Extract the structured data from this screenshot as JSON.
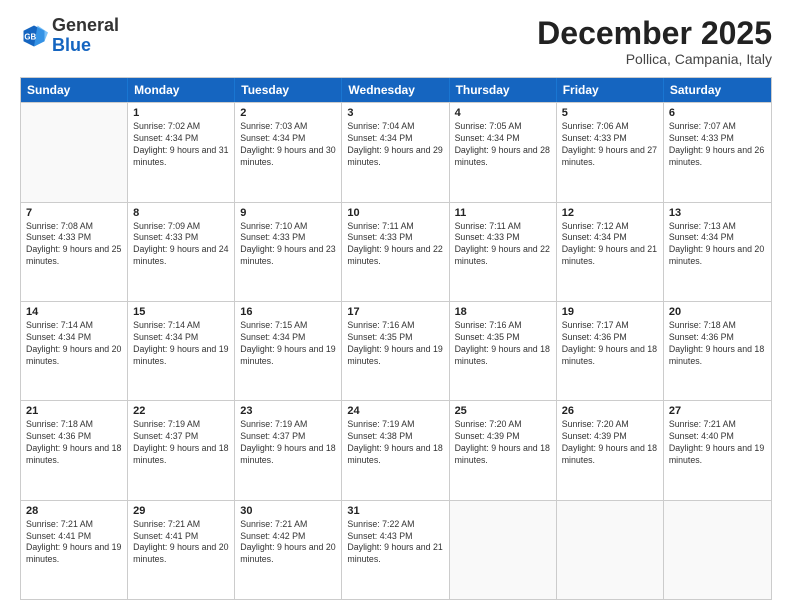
{
  "logo": {
    "general": "General",
    "blue": "Blue"
  },
  "header": {
    "month": "December 2025",
    "location": "Pollica, Campania, Italy"
  },
  "days_of_week": [
    "Sunday",
    "Monday",
    "Tuesday",
    "Wednesday",
    "Thursday",
    "Friday",
    "Saturday"
  ],
  "weeks": [
    [
      {
        "day": "",
        "sunrise": "",
        "sunset": "",
        "daylight": ""
      },
      {
        "day": "1",
        "sunrise": "Sunrise: 7:02 AM",
        "sunset": "Sunset: 4:34 PM",
        "daylight": "Daylight: 9 hours and 31 minutes."
      },
      {
        "day": "2",
        "sunrise": "Sunrise: 7:03 AM",
        "sunset": "Sunset: 4:34 PM",
        "daylight": "Daylight: 9 hours and 30 minutes."
      },
      {
        "day": "3",
        "sunrise": "Sunrise: 7:04 AM",
        "sunset": "Sunset: 4:34 PM",
        "daylight": "Daylight: 9 hours and 29 minutes."
      },
      {
        "day": "4",
        "sunrise": "Sunrise: 7:05 AM",
        "sunset": "Sunset: 4:34 PM",
        "daylight": "Daylight: 9 hours and 28 minutes."
      },
      {
        "day": "5",
        "sunrise": "Sunrise: 7:06 AM",
        "sunset": "Sunset: 4:33 PM",
        "daylight": "Daylight: 9 hours and 27 minutes."
      },
      {
        "day": "6",
        "sunrise": "Sunrise: 7:07 AM",
        "sunset": "Sunset: 4:33 PM",
        "daylight": "Daylight: 9 hours and 26 minutes."
      }
    ],
    [
      {
        "day": "7",
        "sunrise": "Sunrise: 7:08 AM",
        "sunset": "Sunset: 4:33 PM",
        "daylight": "Daylight: 9 hours and 25 minutes."
      },
      {
        "day": "8",
        "sunrise": "Sunrise: 7:09 AM",
        "sunset": "Sunset: 4:33 PM",
        "daylight": "Daylight: 9 hours and 24 minutes."
      },
      {
        "day": "9",
        "sunrise": "Sunrise: 7:10 AM",
        "sunset": "Sunset: 4:33 PM",
        "daylight": "Daylight: 9 hours and 23 minutes."
      },
      {
        "day": "10",
        "sunrise": "Sunrise: 7:11 AM",
        "sunset": "Sunset: 4:33 PM",
        "daylight": "Daylight: 9 hours and 22 minutes."
      },
      {
        "day": "11",
        "sunrise": "Sunrise: 7:11 AM",
        "sunset": "Sunset: 4:33 PM",
        "daylight": "Daylight: 9 hours and 22 minutes."
      },
      {
        "day": "12",
        "sunrise": "Sunrise: 7:12 AM",
        "sunset": "Sunset: 4:34 PM",
        "daylight": "Daylight: 9 hours and 21 minutes."
      },
      {
        "day": "13",
        "sunrise": "Sunrise: 7:13 AM",
        "sunset": "Sunset: 4:34 PM",
        "daylight": "Daylight: 9 hours and 20 minutes."
      }
    ],
    [
      {
        "day": "14",
        "sunrise": "Sunrise: 7:14 AM",
        "sunset": "Sunset: 4:34 PM",
        "daylight": "Daylight: 9 hours and 20 minutes."
      },
      {
        "day": "15",
        "sunrise": "Sunrise: 7:14 AM",
        "sunset": "Sunset: 4:34 PM",
        "daylight": "Daylight: 9 hours and 19 minutes."
      },
      {
        "day": "16",
        "sunrise": "Sunrise: 7:15 AM",
        "sunset": "Sunset: 4:34 PM",
        "daylight": "Daylight: 9 hours and 19 minutes."
      },
      {
        "day": "17",
        "sunrise": "Sunrise: 7:16 AM",
        "sunset": "Sunset: 4:35 PM",
        "daylight": "Daylight: 9 hours and 19 minutes."
      },
      {
        "day": "18",
        "sunrise": "Sunrise: 7:16 AM",
        "sunset": "Sunset: 4:35 PM",
        "daylight": "Daylight: 9 hours and 18 minutes."
      },
      {
        "day": "19",
        "sunrise": "Sunrise: 7:17 AM",
        "sunset": "Sunset: 4:36 PM",
        "daylight": "Daylight: 9 hours and 18 minutes."
      },
      {
        "day": "20",
        "sunrise": "Sunrise: 7:18 AM",
        "sunset": "Sunset: 4:36 PM",
        "daylight": "Daylight: 9 hours and 18 minutes."
      }
    ],
    [
      {
        "day": "21",
        "sunrise": "Sunrise: 7:18 AM",
        "sunset": "Sunset: 4:36 PM",
        "daylight": "Daylight: 9 hours and 18 minutes."
      },
      {
        "day": "22",
        "sunrise": "Sunrise: 7:19 AM",
        "sunset": "Sunset: 4:37 PM",
        "daylight": "Daylight: 9 hours and 18 minutes."
      },
      {
        "day": "23",
        "sunrise": "Sunrise: 7:19 AM",
        "sunset": "Sunset: 4:37 PM",
        "daylight": "Daylight: 9 hours and 18 minutes."
      },
      {
        "day": "24",
        "sunrise": "Sunrise: 7:19 AM",
        "sunset": "Sunset: 4:38 PM",
        "daylight": "Daylight: 9 hours and 18 minutes."
      },
      {
        "day": "25",
        "sunrise": "Sunrise: 7:20 AM",
        "sunset": "Sunset: 4:39 PM",
        "daylight": "Daylight: 9 hours and 18 minutes."
      },
      {
        "day": "26",
        "sunrise": "Sunrise: 7:20 AM",
        "sunset": "Sunset: 4:39 PM",
        "daylight": "Daylight: 9 hours and 18 minutes."
      },
      {
        "day": "27",
        "sunrise": "Sunrise: 7:21 AM",
        "sunset": "Sunset: 4:40 PM",
        "daylight": "Daylight: 9 hours and 19 minutes."
      }
    ],
    [
      {
        "day": "28",
        "sunrise": "Sunrise: 7:21 AM",
        "sunset": "Sunset: 4:41 PM",
        "daylight": "Daylight: 9 hours and 19 minutes."
      },
      {
        "day": "29",
        "sunrise": "Sunrise: 7:21 AM",
        "sunset": "Sunset: 4:41 PM",
        "daylight": "Daylight: 9 hours and 20 minutes."
      },
      {
        "day": "30",
        "sunrise": "Sunrise: 7:21 AM",
        "sunset": "Sunset: 4:42 PM",
        "daylight": "Daylight: 9 hours and 20 minutes."
      },
      {
        "day": "31",
        "sunrise": "Sunrise: 7:22 AM",
        "sunset": "Sunset: 4:43 PM",
        "daylight": "Daylight: 9 hours and 21 minutes."
      },
      {
        "day": "",
        "sunrise": "",
        "sunset": "",
        "daylight": ""
      },
      {
        "day": "",
        "sunrise": "",
        "sunset": "",
        "daylight": ""
      },
      {
        "day": "",
        "sunrise": "",
        "sunset": "",
        "daylight": ""
      }
    ]
  ]
}
